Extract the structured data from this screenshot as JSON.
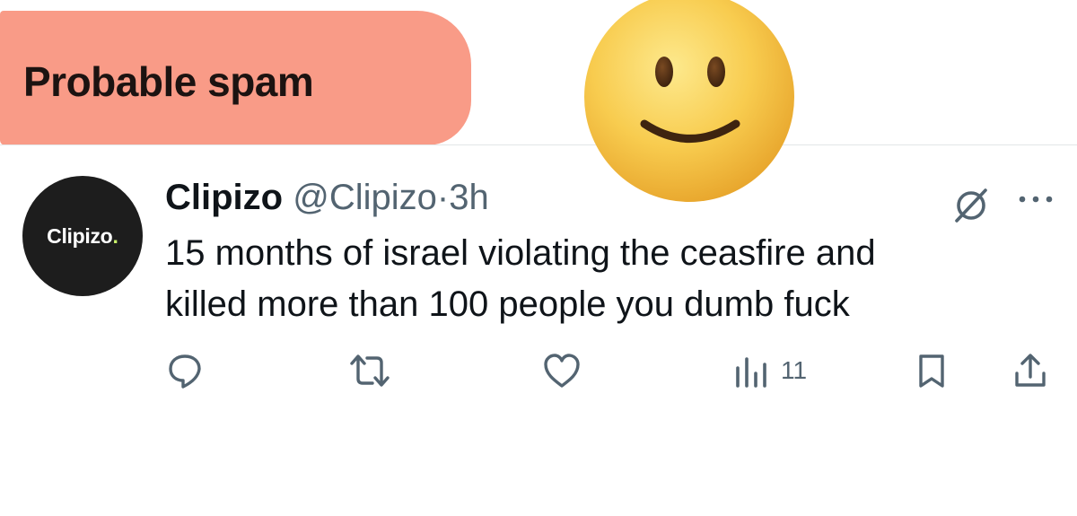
{
  "banner": {
    "label": "Probable spam",
    "color": "#f8937d"
  },
  "overlay_emoji": {
    "icon": "slightly-smiling-face-icon"
  },
  "tweet": {
    "avatar_text": "Clipizo",
    "avatar_dot": ".",
    "author_name": "Clipizo",
    "handle": "@Clipizo",
    "separator": "·",
    "time": "3h",
    "text_line1": "15 months of israel violating the ceasfire and",
    "text_line2": "killed more than 100 people you dumb fuck",
    "header_icons": [
      "grok-icon",
      "more-icon"
    ],
    "actions": [
      {
        "name": "reply",
        "icon": "reply-icon"
      },
      {
        "name": "repost",
        "icon": "repost-icon"
      },
      {
        "name": "like",
        "icon": "heart-icon"
      },
      {
        "name": "views",
        "icon": "views-icon",
        "count": "11"
      },
      {
        "name": "bookmark",
        "icon": "bookmark-icon"
      },
      {
        "name": "share",
        "icon": "share-icon"
      }
    ]
  },
  "colors": {
    "text": "#0f1419",
    "muted": "#536471",
    "divider": "#e3e6e8"
  }
}
